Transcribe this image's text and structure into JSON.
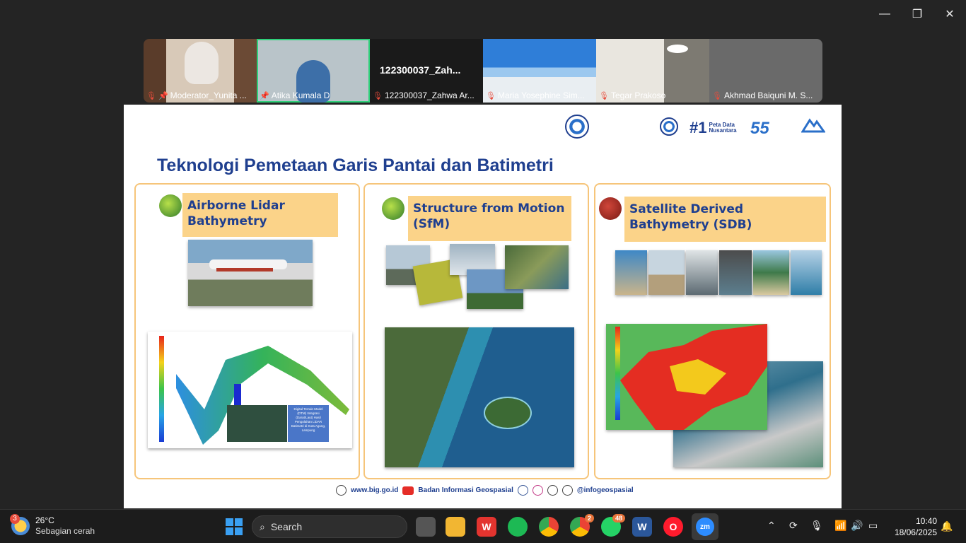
{
  "window": {
    "minimize": "—",
    "maximize": "❐",
    "close": "✕"
  },
  "participants": [
    {
      "name": "Moderator_Yunita ...",
      "pinned": true,
      "muted": true,
      "active": false,
      "bg": "#6b4a35"
    },
    {
      "name": "Atika Kumala D",
      "pinned": true,
      "muted": false,
      "active": true,
      "bg": "#b9c4c9"
    },
    {
      "name": "122300037_Zahwa Ar...",
      "pinned": false,
      "muted": true,
      "active": false,
      "bg": "#1a1a1a",
      "display": "122300037_Zah..."
    },
    {
      "name": "Maria Yosephine Sim...",
      "pinned": false,
      "muted": true,
      "active": false,
      "bg": "#3b86d4"
    },
    {
      "name": "Tegar Prakoso",
      "pinned": false,
      "muted": true,
      "active": false,
      "bg": "#8c8a85"
    },
    {
      "name": "Akhmad Baiquni M. S...",
      "pinned": false,
      "muted": true,
      "active": false,
      "bg": "#6a6a6a"
    }
  ],
  "slide": {
    "title": "Teknologi Pemetaan Garis Pantai dan Batimetri",
    "logos": {
      "rank": "#1",
      "rank_text": "Peta Data Nusantara",
      "anniv": "55"
    },
    "panels": [
      {
        "title": "Airborne Lidar Bathymetry",
        "caption": "Digital Terrain Model (DTM) Integrasi (Darat/Laut) Hasil Pengolahan LiDAR Batimetri di Kota Agung, Lampung"
      },
      {
        "title": "Structure from Motion (SfM)"
      },
      {
        "title": "Satellite Derived Bathymetry (SDB)"
      }
    ],
    "footer": {
      "website": "www.big.go.id",
      "channel": "Badan Informasi Geospasial",
      "handle": "@infogeospasial"
    }
  },
  "taskbar": {
    "weather": {
      "badge": "3",
      "temp": "26°C",
      "desc": "Sebagian cerah"
    },
    "search_placeholder": "Search",
    "apps": [
      {
        "name": "task-view",
        "badge": ""
      },
      {
        "name": "file-explorer",
        "badge": ""
      },
      {
        "name": "wps-office",
        "badge": ""
      },
      {
        "name": "spotify",
        "badge": ""
      },
      {
        "name": "chrome-profile",
        "badge": ""
      },
      {
        "name": "chrome",
        "badge": "2"
      },
      {
        "name": "whatsapp",
        "badge": "48"
      },
      {
        "name": "word",
        "badge": ""
      },
      {
        "name": "opera",
        "badge": ""
      },
      {
        "name": "zoom",
        "badge": ""
      }
    ],
    "clock": {
      "time": "10:40",
      "date": "18/06/2025"
    }
  }
}
